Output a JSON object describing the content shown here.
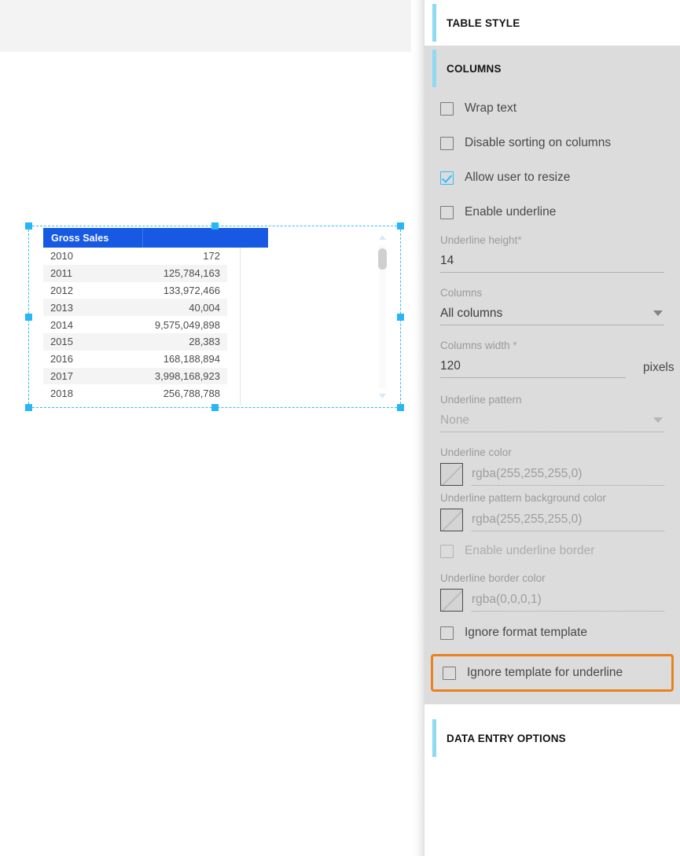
{
  "panel": {
    "sections": [
      {
        "id": "table-style",
        "title": "TABLE STYLE"
      },
      {
        "id": "columns",
        "title": "COLUMNS"
      },
      {
        "id": "data-entry-options",
        "title": "DATA ENTRY OPTIONS"
      }
    ],
    "accent_color": "#8fd9f2",
    "highlight_color": "#e8821e",
    "checkbox_checked_color": "#33bdf4",
    "columns_section": {
      "checkboxes": [
        {
          "label": "Wrap text",
          "checked": false,
          "disabled": false
        },
        {
          "label": "Disable sorting on columns",
          "checked": false,
          "disabled": false
        },
        {
          "label": "Allow user to resize",
          "checked": true,
          "disabled": false
        },
        {
          "label": "Enable underline",
          "checked": false,
          "disabled": false
        }
      ],
      "underline_height": {
        "label": "Underline height",
        "required": "*",
        "value": "14"
      },
      "columns_select": {
        "label": "Columns",
        "value": "All columns"
      },
      "columns_width": {
        "label": "Columns width",
        "required": "*",
        "value": "120",
        "unit": "pixels"
      },
      "underline_pattern": {
        "label": "Underline pattern",
        "value": "None"
      },
      "underline_color": {
        "label": "Underline color",
        "value": "rgba(255,255,255,0)"
      },
      "underline_pattern_bg_color": {
        "label": "Underline pattern background color",
        "value": "rgba(255,255,255,0)"
      },
      "enable_underline_border": {
        "label": "Enable underline border",
        "checked": false,
        "disabled": true
      },
      "underline_border_color": {
        "label": "Underline border color",
        "value": "rgba(0,0,0,1)"
      },
      "ignore_format_template": {
        "label": "Ignore format template",
        "checked": false
      },
      "ignore_template_for_underline": {
        "label": "Ignore template for underline",
        "checked": false,
        "highlighted": true
      }
    }
  },
  "canvas": {
    "table_widget": {
      "header_color": "#1759e3",
      "columns": [
        "Gross Sales",
        ""
      ],
      "rows": [
        {
          "year": "2010",
          "value": "172"
        },
        {
          "year": "2011",
          "value": "125,784,163"
        },
        {
          "year": "2012",
          "value": "133,972,466"
        },
        {
          "year": "2013",
          "value": "40,004"
        },
        {
          "year": "2014",
          "value": "9,575,049,898"
        },
        {
          "year": "2015",
          "value": "28,383"
        },
        {
          "year": "2016",
          "value": "168,188,894"
        },
        {
          "year": "2017",
          "value": "3,998,168,923"
        },
        {
          "year": "2018",
          "value": "256,788,788"
        }
      ]
    }
  }
}
